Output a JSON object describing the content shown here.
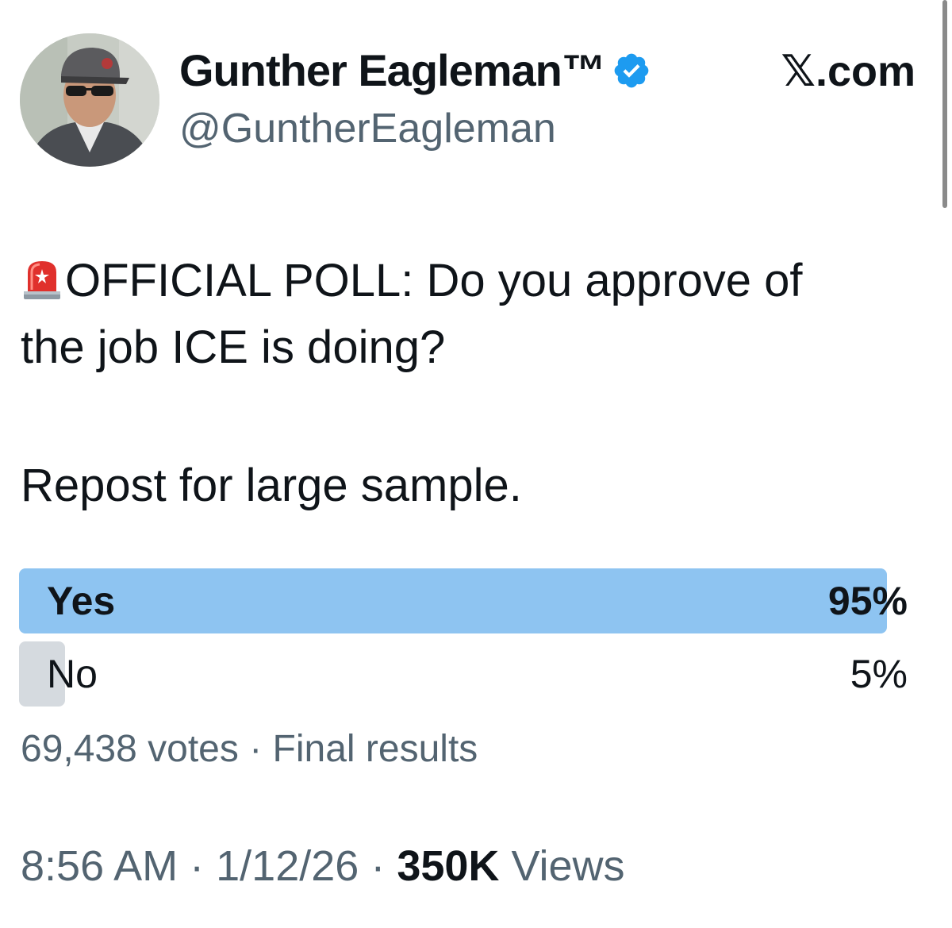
{
  "author": {
    "display_name": "Gunther Eagleman™",
    "handle": "@GuntherEagleman",
    "verified_icon": "verified-badge-icon"
  },
  "brand": {
    "label": "𝕏.com"
  },
  "tweet": {
    "icon": "rotating-light-icon",
    "line1": "OFFICIAL POLL:  Do you approve of",
    "line2": "the job ICE is doing?",
    "line3": "Repost for large sample."
  },
  "poll": {
    "options": [
      {
        "label": "Yes",
        "percent": "95%",
        "fraction": 0.95,
        "winner": true
      },
      {
        "label": "No",
        "percent": "5%",
        "fraction": 0.05,
        "winner": false
      }
    ],
    "votes": "69,438 votes",
    "separator": "·",
    "status": "Final results"
  },
  "meta": {
    "time": "8:56 AM",
    "separator": "·",
    "date": "1/12/26",
    "views_count": "350K",
    "views_label": "Views"
  },
  "colors": {
    "winner_bar": "#8ec4f1",
    "loser_bar": "#d5dadf",
    "verified": "#1d9bf0",
    "secondary_text": "#536471"
  }
}
